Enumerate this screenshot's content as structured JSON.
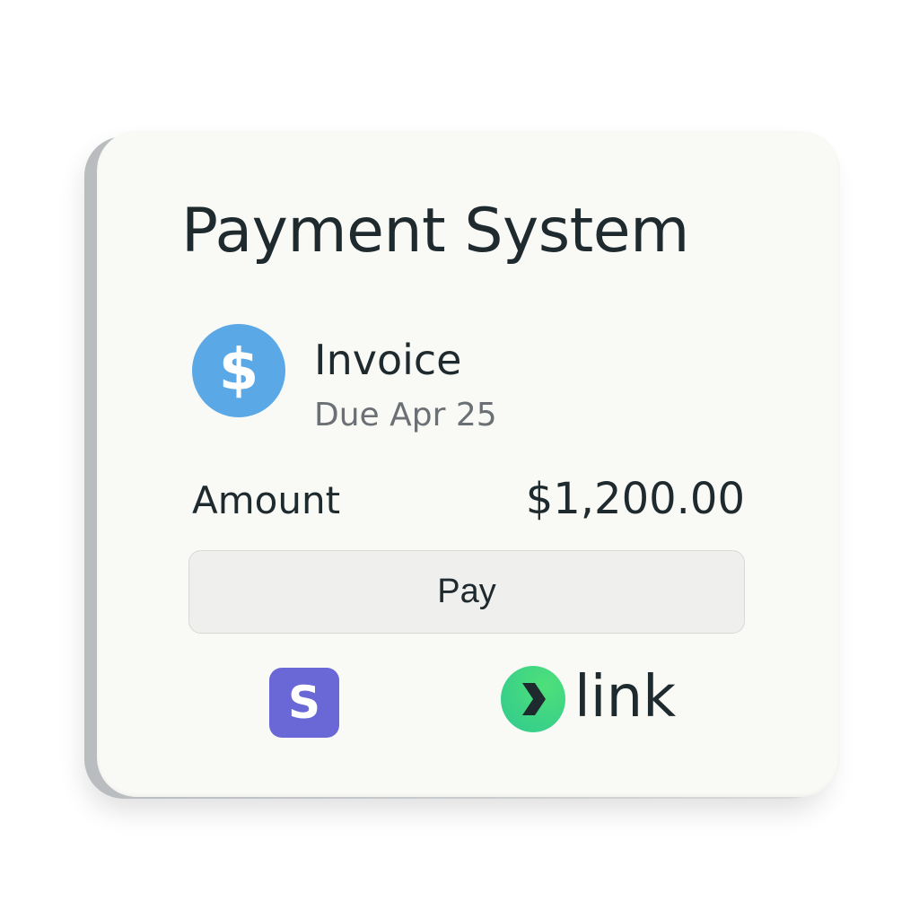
{
  "card": {
    "title": "Payment System",
    "invoice": {
      "icon": "dollar-coin-icon",
      "icon_glyph": "$",
      "label": "Invoice",
      "due": "Due Apr 25"
    },
    "amount": {
      "label": "Amount",
      "value": "$1,200.00"
    },
    "pay_button": "Pay",
    "providers": [
      {
        "icon": "stripe-s-icon",
        "glyph": "S",
        "color": "#6a67d6"
      },
      {
        "icon": "link-chevron-icon",
        "label": "link",
        "color": "#3ed67f"
      }
    ]
  }
}
